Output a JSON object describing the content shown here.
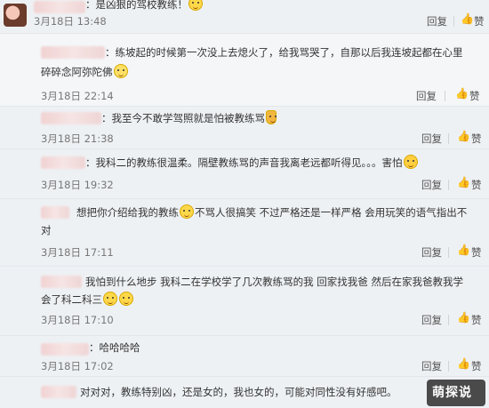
{
  "comments": [
    {
      "text": "：是凶狠的驾校教练！",
      "date": "3月18日 13:48",
      "reply": "回复",
      "like": "赞"
    },
    {
      "text_line1": "：练坡起的时候第一次没上去熄火了，给我骂哭了，自那以后我连坡起都在心里",
      "text_line2": "碎碎念阿弥陀佛",
      "date": "3月18日 22:14",
      "reply": "回复",
      "like": "赞"
    },
    {
      "text": "：我至今不敢学驾照就是怕被教练骂",
      "date": "3月18日 21:38",
      "reply": "回复",
      "like": "赞"
    },
    {
      "text_a": "：我科二的教练很温柔。隔壁教练骂的声音我离老远都听得见。。。害怕",
      "date": "3月18日 19:32",
      "reply": "回复",
      "like": "赞"
    },
    {
      "text_a": "想把你介绍给我的教练",
      "text_b": "不骂人很搞笑 不过严格还是一样严格 会用玩笑的语气指出不",
      "text_line2": "对",
      "date": "3月18日 17:11",
      "reply": "回复",
      "like": "赞"
    },
    {
      "text_line1": "我怕到什么地步 我科二在学校学了几次教练骂的我 回家找我爸 然后在家我爸教我学",
      "text_line2": "会了科二科三",
      "date": "3月18日 17:10",
      "reply": "回复",
      "like": "赞"
    },
    {
      "text": "：哈哈哈哈",
      "date": "3月18日 17:02",
      "reply": "回复",
      "like": "赞"
    },
    {
      "text": "对对对，教练特别凶，还是女的，我也女的，可能对同性没有好感吧。"
    }
  ],
  "icons": {
    "thumb": "thumbs-up-icon",
    "emoji": "emoji-icon"
  },
  "watermark": {
    "text": "萌探说"
  },
  "colors": {
    "background": "#eef1f4",
    "text": "#333333",
    "meta": "#777777"
  }
}
